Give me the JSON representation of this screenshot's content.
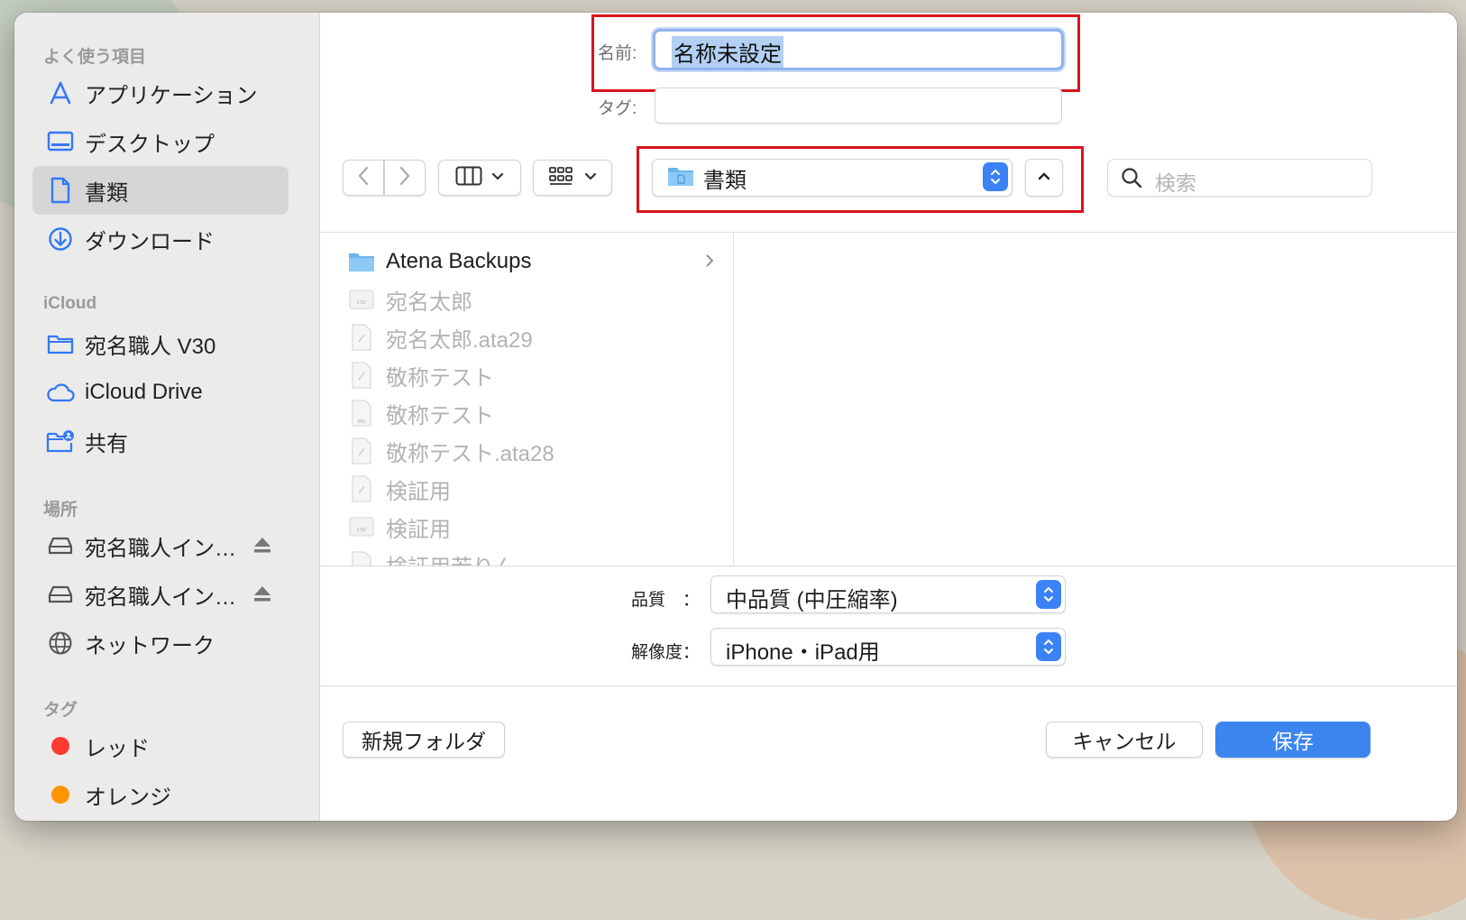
{
  "sidebar": {
    "favorites_header": "よく使う項目",
    "favorites": [
      {
        "label": "アプリケーション",
        "icon": "applications-icon"
      },
      {
        "label": "デスクトップ",
        "icon": "desktop-icon"
      },
      {
        "label": "書類",
        "icon": "document-icon",
        "selected": true
      },
      {
        "label": "ダウンロード",
        "icon": "download-icon"
      }
    ],
    "icloud_header": "iCloud",
    "icloud": [
      {
        "label": "宛名職人 V30",
        "icon": "folder-icon"
      },
      {
        "label": "iCloud Drive",
        "icon": "cloud-icon"
      },
      {
        "label": "共有",
        "icon": "shared-folder-icon"
      }
    ],
    "locations_header": "場所",
    "locations": [
      {
        "label": "宛名職人イン…",
        "icon": "drive-icon",
        "eject": true
      },
      {
        "label": "宛名職人イン…",
        "icon": "drive-icon",
        "eject": true
      },
      {
        "label": "ネットワーク",
        "icon": "network-icon"
      }
    ],
    "tags_header": "タグ",
    "tags": [
      {
        "label": "レッド",
        "color": "#ff3b30"
      },
      {
        "label": "オレンジ",
        "color": "#ff9500"
      }
    ]
  },
  "form": {
    "name_label": "名前:",
    "name_value": "名称未設定",
    "tag_label": "タグ:",
    "tag_value": ""
  },
  "toolbar": {
    "location": "書類",
    "search_placeholder": "検索"
  },
  "files": [
    {
      "name": "Atena Backups",
      "type": "folder",
      "enabled": true
    },
    {
      "name": "宛名太郎",
      "type": "csv",
      "enabled": false
    },
    {
      "name": "宛名太郎.ata29",
      "type": "doc",
      "enabled": false
    },
    {
      "name": "敬称テスト",
      "type": "doc",
      "enabled": false
    },
    {
      "name": "敬称テスト",
      "type": "xml",
      "enabled": false
    },
    {
      "name": "敬称テスト.ata28",
      "type": "doc",
      "enabled": false
    },
    {
      "name": "検証用",
      "type": "doc",
      "enabled": false
    },
    {
      "name": "検証用",
      "type": "csv",
      "enabled": false
    },
    {
      "name": "検証用若りん",
      "type": "doc",
      "enabled": false
    }
  ],
  "options": {
    "quality_label": "品質　：",
    "quality_value": "中品質 (中圧縮率)",
    "resolution_label": "解像度：",
    "resolution_value": "iPhone・iPad用"
  },
  "footer": {
    "new_folder": "新規フォルダ",
    "cancel": "キャンセル",
    "save": "保存"
  },
  "colors": {
    "accent": "#3d85ee",
    "highlight_box": "#d7141e",
    "selection": "#b3d0f4"
  }
}
